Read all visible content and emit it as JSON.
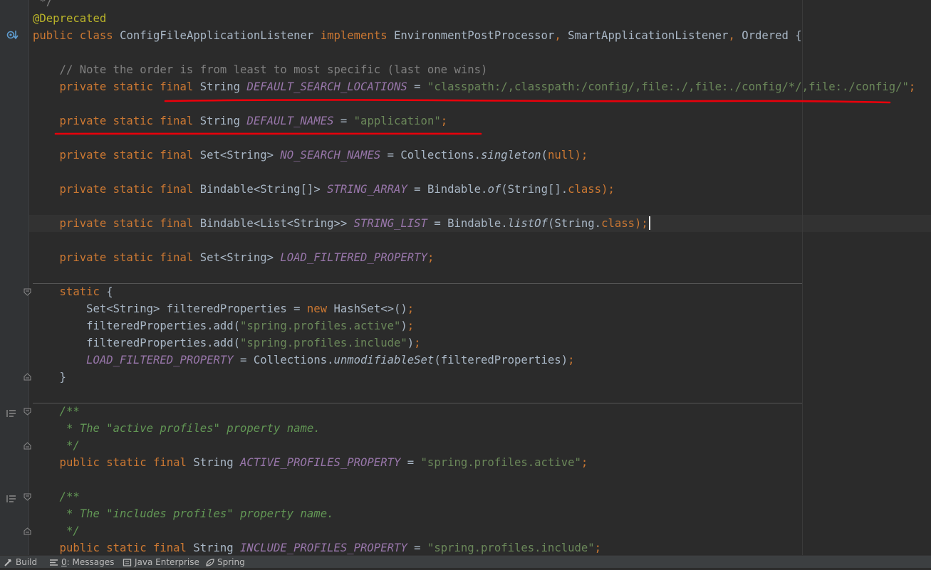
{
  "editor": {
    "lines": [
      {
        "segments": [
          {
            "t": " */",
            "c": "cmt"
          }
        ]
      },
      {
        "segments": [
          {
            "t": "@Deprecated",
            "c": "ann"
          }
        ]
      },
      {
        "segments": [
          {
            "t": "public class ",
            "c": "kw"
          },
          {
            "t": "ConfigFileApplicationListener ",
            "c": "id"
          },
          {
            "t": "implements ",
            "c": "kw"
          },
          {
            "t": "EnvironmentPostProcessor",
            "c": "id"
          },
          {
            "t": ", ",
            "c": "kw"
          },
          {
            "t": "SmartApplicationListener",
            "c": "id"
          },
          {
            "t": ", ",
            "c": "kw"
          },
          {
            "t": "Ordered {",
            "c": "id"
          }
        ]
      },
      {
        "segments": []
      },
      {
        "segments": [
          {
            "t": "    // Note the order is from least to most specific (last one wins)",
            "c": "cmt"
          }
        ]
      },
      {
        "segments": [
          {
            "t": "    private static final ",
            "c": "kw"
          },
          {
            "t": "String ",
            "c": "id"
          },
          {
            "t": "DEFAULT_SEARCH_LOCATIONS",
            "c": "cst"
          },
          {
            "t": " = ",
            "c": "id"
          },
          {
            "t": "\"classpath:/,classpath:/config/,file:./,file:./config/*/,file:./config/\"",
            "c": "str"
          },
          {
            "t": ";",
            "c": "kw"
          }
        ]
      },
      {
        "segments": []
      },
      {
        "segments": [
          {
            "t": "    private static final ",
            "c": "kw"
          },
          {
            "t": "String ",
            "c": "id"
          },
          {
            "t": "DEFAULT_NAMES",
            "c": "cst"
          },
          {
            "t": " = ",
            "c": "id"
          },
          {
            "t": "\"application\"",
            "c": "str"
          },
          {
            "t": ";",
            "c": "kw"
          }
        ]
      },
      {
        "segments": []
      },
      {
        "segments": [
          {
            "t": "    private static final ",
            "c": "kw"
          },
          {
            "t": "Set<String> ",
            "c": "id"
          },
          {
            "t": "NO_SEARCH_NAMES",
            "c": "cst"
          },
          {
            "t": " = Collections.",
            "c": "id"
          },
          {
            "t": "singleton",
            "c": "it"
          },
          {
            "t": "(",
            "c": "id"
          },
          {
            "t": "null",
            "c": "kw"
          },
          {
            "t": ");",
            "c": "kw"
          }
        ]
      },
      {
        "segments": []
      },
      {
        "segments": [
          {
            "t": "    private static final ",
            "c": "kw"
          },
          {
            "t": "Bindable<String[]> ",
            "c": "id"
          },
          {
            "t": "STRING_ARRAY",
            "c": "cst"
          },
          {
            "t": " = Bindable.",
            "c": "id"
          },
          {
            "t": "of",
            "c": "it"
          },
          {
            "t": "(String[].",
            "c": "id"
          },
          {
            "t": "class",
            "c": "kw"
          },
          {
            "t": ");",
            "c": "kw"
          }
        ]
      },
      {
        "segments": []
      },
      {
        "segments": [
          {
            "t": "    private static final ",
            "c": "kw"
          },
          {
            "t": "Bindable<List<String>> ",
            "c": "id"
          },
          {
            "t": "STRING_LIST",
            "c": "cst"
          },
          {
            "t": " = Bindable.",
            "c": "id"
          },
          {
            "t": "listOf",
            "c": "it"
          },
          {
            "t": "(String.",
            "c": "id"
          },
          {
            "t": "class",
            "c": "kw"
          },
          {
            "t": ");",
            "c": "kw"
          }
        ],
        "caret": true
      },
      {
        "segments": []
      },
      {
        "segments": [
          {
            "t": "    private static final ",
            "c": "kw"
          },
          {
            "t": "Set<String> ",
            "c": "id"
          },
          {
            "t": "LOAD_FILTERED_PROPERTY",
            "c": "cst"
          },
          {
            "t": ";",
            "c": "kw"
          }
        ]
      },
      {
        "segments": []
      },
      {
        "segments": [
          {
            "t": "    static ",
            "c": "kw"
          },
          {
            "t": "{",
            "c": "id"
          }
        ]
      },
      {
        "segments": [
          {
            "t": "        Set<String> filteredProperties = ",
            "c": "id"
          },
          {
            "t": "new ",
            "c": "kw"
          },
          {
            "t": "HashSet<>()",
            "c": "id"
          },
          {
            "t": ";",
            "c": "kw"
          }
        ]
      },
      {
        "segments": [
          {
            "t": "        filteredProperties.add(",
            "c": "id"
          },
          {
            "t": "\"spring.profiles.active\"",
            "c": "str"
          },
          {
            "t": ")",
            "c": "id"
          },
          {
            "t": ";",
            "c": "kw"
          }
        ]
      },
      {
        "segments": [
          {
            "t": "        filteredProperties.add(",
            "c": "id"
          },
          {
            "t": "\"spring.profiles.include\"",
            "c": "str"
          },
          {
            "t": ")",
            "c": "id"
          },
          {
            "t": ";",
            "c": "kw"
          }
        ]
      },
      {
        "segments": [
          {
            "t": "        ",
            "c": "id"
          },
          {
            "t": "LOAD_FILTERED_PROPERTY",
            "c": "cst"
          },
          {
            "t": " = Collections.",
            "c": "id"
          },
          {
            "t": "unmodifiableSet",
            "c": "it"
          },
          {
            "t": "(filteredProperties)",
            "c": "id"
          },
          {
            "t": ";",
            "c": "kw"
          }
        ]
      },
      {
        "segments": [
          {
            "t": "    }",
            "c": "id"
          }
        ]
      },
      {
        "segments": []
      },
      {
        "segments": [
          {
            "t": "    /**",
            "c": "doc"
          }
        ]
      },
      {
        "segments": [
          {
            "t": "     * The \"active profiles\" property name.",
            "c": "doc"
          }
        ]
      },
      {
        "segments": [
          {
            "t": "     */",
            "c": "doc"
          }
        ]
      },
      {
        "segments": [
          {
            "t": "    public static final ",
            "c": "kw"
          },
          {
            "t": "String ",
            "c": "id"
          },
          {
            "t": "ACTIVE_PROFILES_PROPERTY",
            "c": "cst"
          },
          {
            "t": " = ",
            "c": "id"
          },
          {
            "t": "\"spring.profiles.active\"",
            "c": "str"
          },
          {
            "t": ";",
            "c": "kw"
          }
        ]
      },
      {
        "segments": []
      },
      {
        "segments": [
          {
            "t": "    /**",
            "c": "doc"
          }
        ]
      },
      {
        "segments": [
          {
            "t": "     * The \"includes profiles\" property name.",
            "c": "doc"
          }
        ]
      },
      {
        "segments": [
          {
            "t": "     */",
            "c": "doc"
          }
        ]
      },
      {
        "segments": [
          {
            "t": "    public static final ",
            "c": "kw"
          },
          {
            "t": "String ",
            "c": "id"
          },
          {
            "t": "INCLUDE_PROFILES_PROPERTY",
            "c": "cst"
          },
          {
            "t": " = ",
            "c": "id"
          },
          {
            "t": "\"spring.profiles.include\"",
            "c": "str"
          },
          {
            "t": ";",
            "c": "kw"
          }
        ]
      }
    ]
  },
  "annotation_color": "#e8000b",
  "statusbar": {
    "build": "Build",
    "messages_num": "0",
    "messages_rest": ": Messages",
    "java_enterprise": "Java Enterprise",
    "spring": "Spring"
  }
}
